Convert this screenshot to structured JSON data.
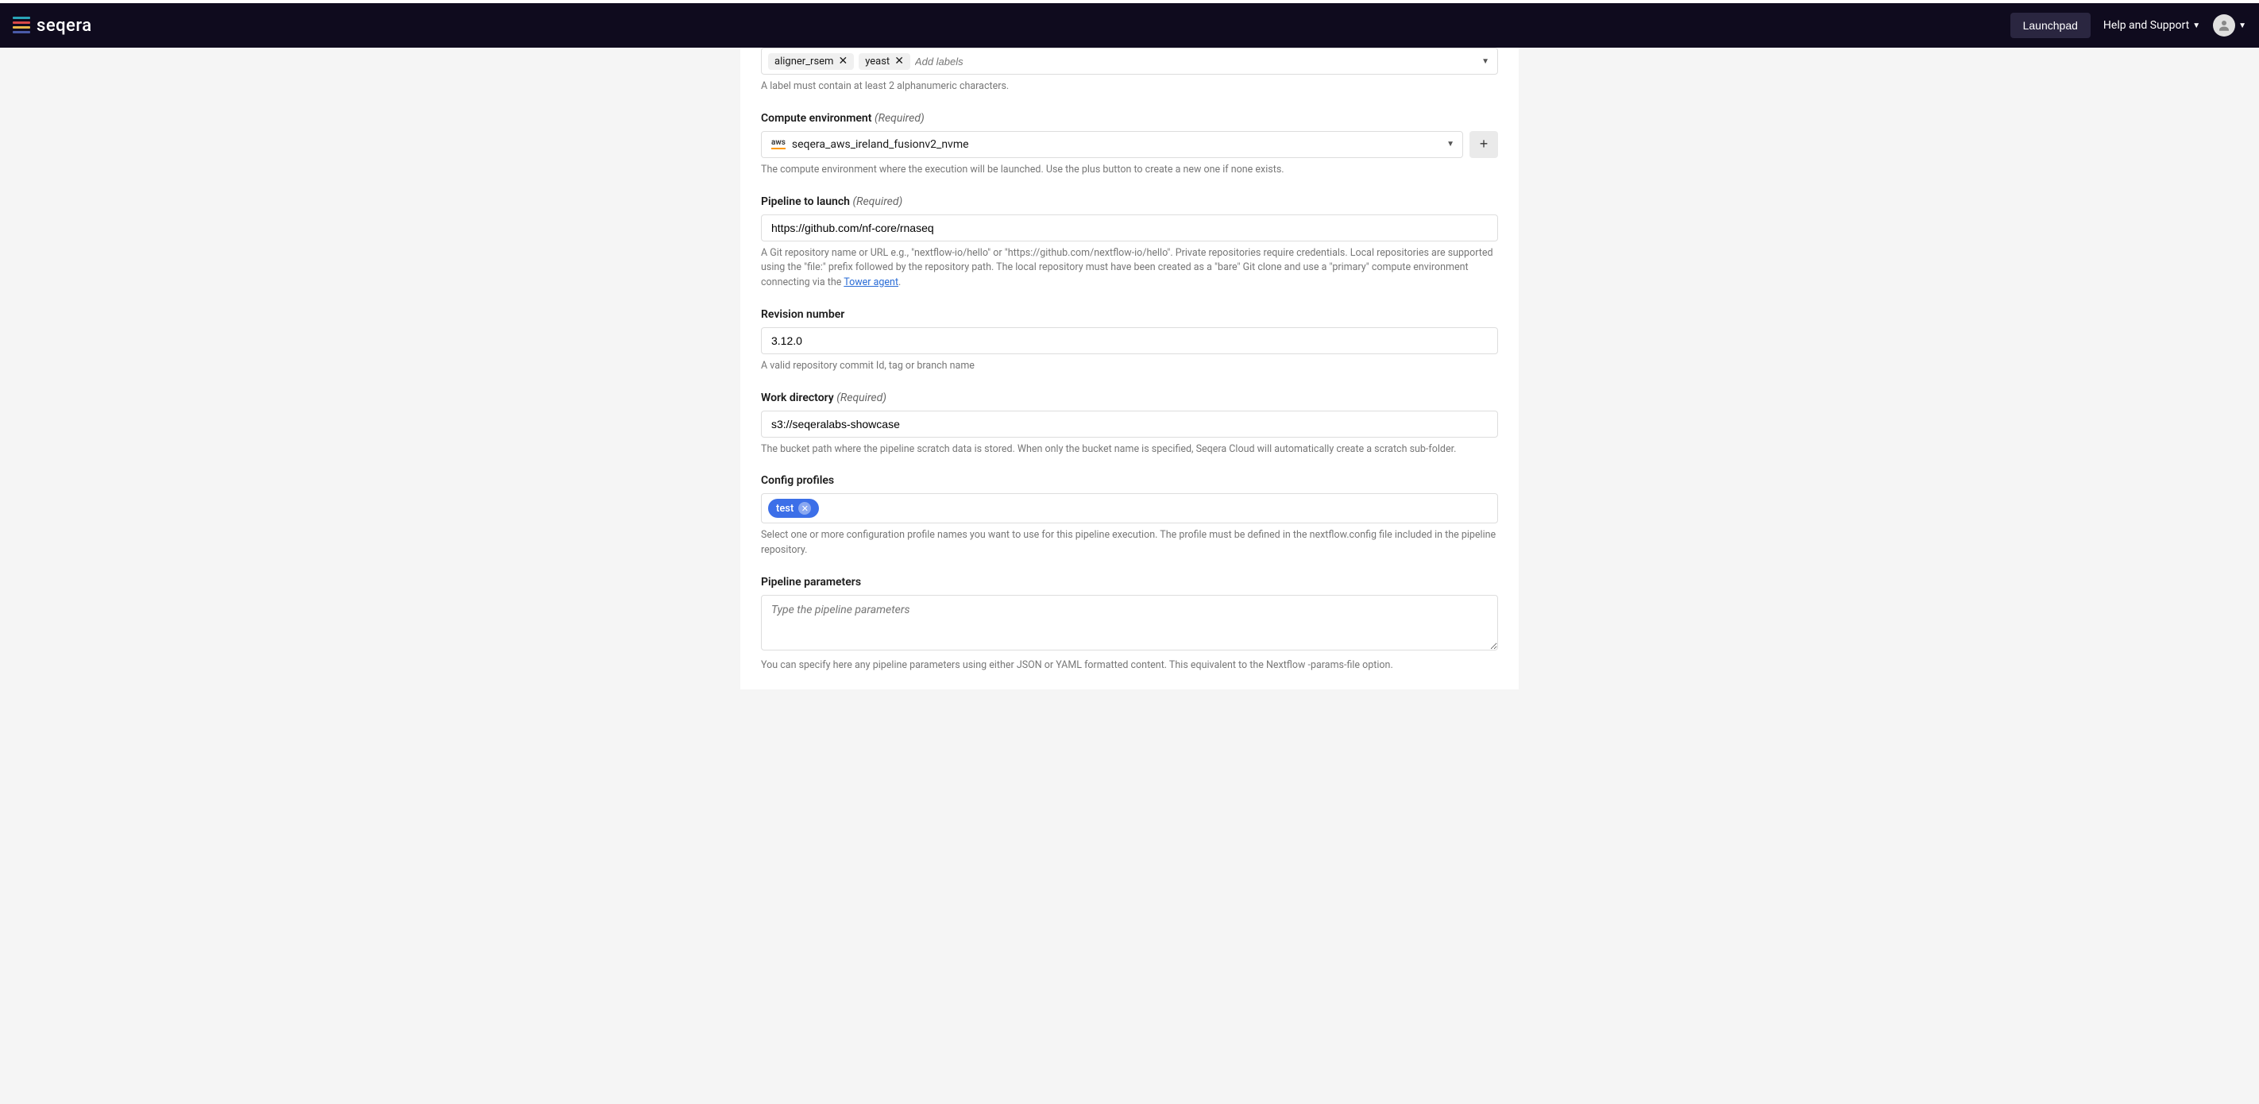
{
  "brand": "seqera",
  "header": {
    "launchpad": "Launchpad",
    "help_support": "Help and Support"
  },
  "labels": {
    "chips": [
      "aligner_rsem",
      "yeast"
    ],
    "placeholder": "Add labels",
    "help": "A label must contain at least 2 alphanumeric characters."
  },
  "compute_env": {
    "label": "Compute environment",
    "required": "(Required)",
    "provider": "aws",
    "value": "seqera_aws_ireland_fusionv2_nvme",
    "plus": "+",
    "help": "The compute environment where the execution will be launched. Use the plus button to create a new one if none exists."
  },
  "pipeline": {
    "label": "Pipeline to launch",
    "required": "(Required)",
    "value": "https://github.com/nf-core/rnaseq",
    "help_pre": "A Git repository name or URL e.g., \"nextflow-io/hello\" or \"https://github.com/nextflow-io/hello\". Private repositories require credentials. Local repositories are supported using the \"file:\" prefix followed by the repository path. The local repository must have been created as a \"bare\" Git clone and use a \"primary\" compute environment connecting via the ",
    "help_link": "Tower agent",
    "help_post": "."
  },
  "revision": {
    "label": "Revision number",
    "value": "3.12.0",
    "help": "A valid repository commit Id, tag or branch name"
  },
  "workdir": {
    "label": "Work directory",
    "required": "(Required)",
    "value": "s3://seqeralabs-showcase",
    "help": "The bucket path where the pipeline scratch data is stored. When only the bucket name is specified, Seqera Cloud will automatically create a scratch sub-folder."
  },
  "profiles": {
    "label": "Config profiles",
    "chip": "test",
    "help": "Select one or more configuration profile names you want to use for this pipeline execution. The profile must be defined in the nextflow.config file included in the pipeline repository."
  },
  "params": {
    "label": "Pipeline parameters",
    "placeholder": "Type the pipeline parameters",
    "help": "You can specify here any pipeline parameters using either JSON or YAML formatted content. This equivalent to the Nextflow -params-file option."
  }
}
